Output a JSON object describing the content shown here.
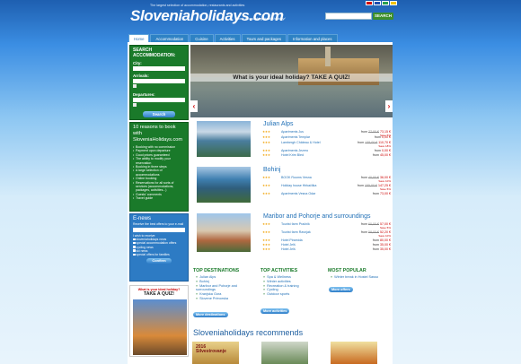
{
  "header": {
    "tagline": "The largest selection of accommodation, restaurants and activities",
    "site_name": "Sloveniaholidays.com",
    "slogan": "Book your unforgettable holiday!",
    "search_button": "SEARCH",
    "flags": [
      "#d00000",
      "#1e4fb0",
      "#2aa050",
      "#f4c400"
    ]
  },
  "nav": {
    "tabs": [
      "Home",
      "Accommodation",
      "Cuisine",
      "Activities",
      "Tours and packages",
      "Information and places"
    ]
  },
  "search": {
    "heading": "SEARCH ACCOMMODATION:",
    "city_label": "City:",
    "arrivals_label": "Arrivals:",
    "departures_label": "Departures:",
    "button": "Search"
  },
  "reasons": {
    "heading": "10 reasons to book with SloveniaHolidays.com",
    "items": [
      "Booking with no commission",
      "Payment upon departure",
      "Good prices guaranteed",
      "The ability to modify your reservation",
      "Booking in three steps",
      "A large selection of accommodations",
      "Online booking",
      "Reservations for all sorts of services (accommodations, packages, activities...)",
      "Guests' comments",
      "Travel guide"
    ]
  },
  "enews": {
    "heading": "E-news",
    "text": "Receive the best offers to your e-mail",
    "sub_label": "I wish to receive:",
    "options": [
      "sloveniaholidays news",
      "special accommodation offers",
      "cycling news",
      "ski news",
      "special offers for families"
    ],
    "button": "Confirm"
  },
  "quiz_ad": {
    "question": "What is your ideal holiday?",
    "cta": "TAKE A QUIZ!"
  },
  "hero": {
    "question": "What is your ideal holiday? TAKE A QUIZ!",
    "prev": "‹",
    "next": "›"
  },
  "destinations": [
    {
      "title": "Julian Alps",
      "rows": [
        {
          "stars": "★★★",
          "name": "Apartments Jus",
          "from": "from",
          "old": "77,00 €",
          "price": "73,15 €",
          "save": "Save 5%"
        },
        {
          "stars": "★★★",
          "name": "Apartments Templar",
          "from": "from",
          "old": "",
          "price": "0,00 €",
          "save": ""
        },
        {
          "stars": "★★★",
          "name": "Lambergh Château & Hotel",
          "from": "from",
          "old": "135,00 €",
          "price": "110,70 €",
          "save": "Save 18%"
        },
        {
          "stars": "★★★",
          "name": "Apartments Jezero",
          "from": "from",
          "old": "",
          "price": "0,00 €",
          "save": ""
        },
        {
          "stars": "★★★",
          "name": "Hotel Krim Bled",
          "from": "from",
          "old": "",
          "price": "45,00 €",
          "save": ""
        }
      ]
    },
    {
      "title": "Bohinj",
      "rows": [
        {
          "stars": "★★★",
          "name": "BOOK Rooms Vesna",
          "from": "from",
          "old": "40,00 €",
          "price": "36,00 €",
          "save": "Save 10%"
        },
        {
          "stars": "★★★",
          "name": "Holiday house Hirkačiika",
          "from": "from",
          "old": "155,00 €",
          "price": "147,25 €",
          "save": "Save 5%"
        },
        {
          "stars": "★★★",
          "name": "Apartments Vesna Odar",
          "from": "from",
          "old": "",
          "price": "73,00 €",
          "save": ""
        }
      ]
    },
    {
      "title": "Maribor and Pohorje and surroundings",
      "rows": [
        {
          "stars": "★★★",
          "name": "Tourist farm Pračnik",
          "from": "from",
          "old": "60,00 €",
          "price": "57,00 €",
          "save": "Save 5%"
        },
        {
          "stars": "★★★",
          "name": "Tourist farm Ravnjak",
          "from": "from",
          "old": "58,00 €",
          "price": "52,20 €",
          "save": "Save 10%"
        },
        {
          "stars": "★★★",
          "name": "Hotel Piramida",
          "from": "from",
          "old": "",
          "price": "80,00 €",
          "save": ""
        },
        {
          "stars": "★★★",
          "name": "Hotel Jelš",
          "from": "from",
          "old": "",
          "price": "35,00 €",
          "save": ""
        },
        {
          "stars": "★★★",
          "name": "Hotel Jelš",
          "from": "from",
          "old": "",
          "price": "35,00 €",
          "save": ""
        }
      ]
    }
  ],
  "top_destinations": {
    "heading": "TOP DESTINATIONS",
    "items": [
      "Julian Alps",
      "Bohinj",
      "Maribor and Pohorje and surroundings",
      "Kranjska Gora",
      "Slovene Primorska"
    ],
    "more": "More destinations"
  },
  "top_activities": {
    "heading": "TOP ACTIVITIES",
    "items": [
      "Spa & Wellness",
      "Winter activities",
      "Recreation & training",
      "Cycling",
      "Outdoor sports"
    ],
    "more": "More activities"
  },
  "most_popular": {
    "heading": "MOST POPULAR",
    "items": [
      "Winter break in Hostel Sasso"
    ],
    "more": "More offers"
  },
  "recommends": {
    "heading": "Sloveniaholidays recommends",
    "card1_text": "2016 Silvestrovanje"
  }
}
